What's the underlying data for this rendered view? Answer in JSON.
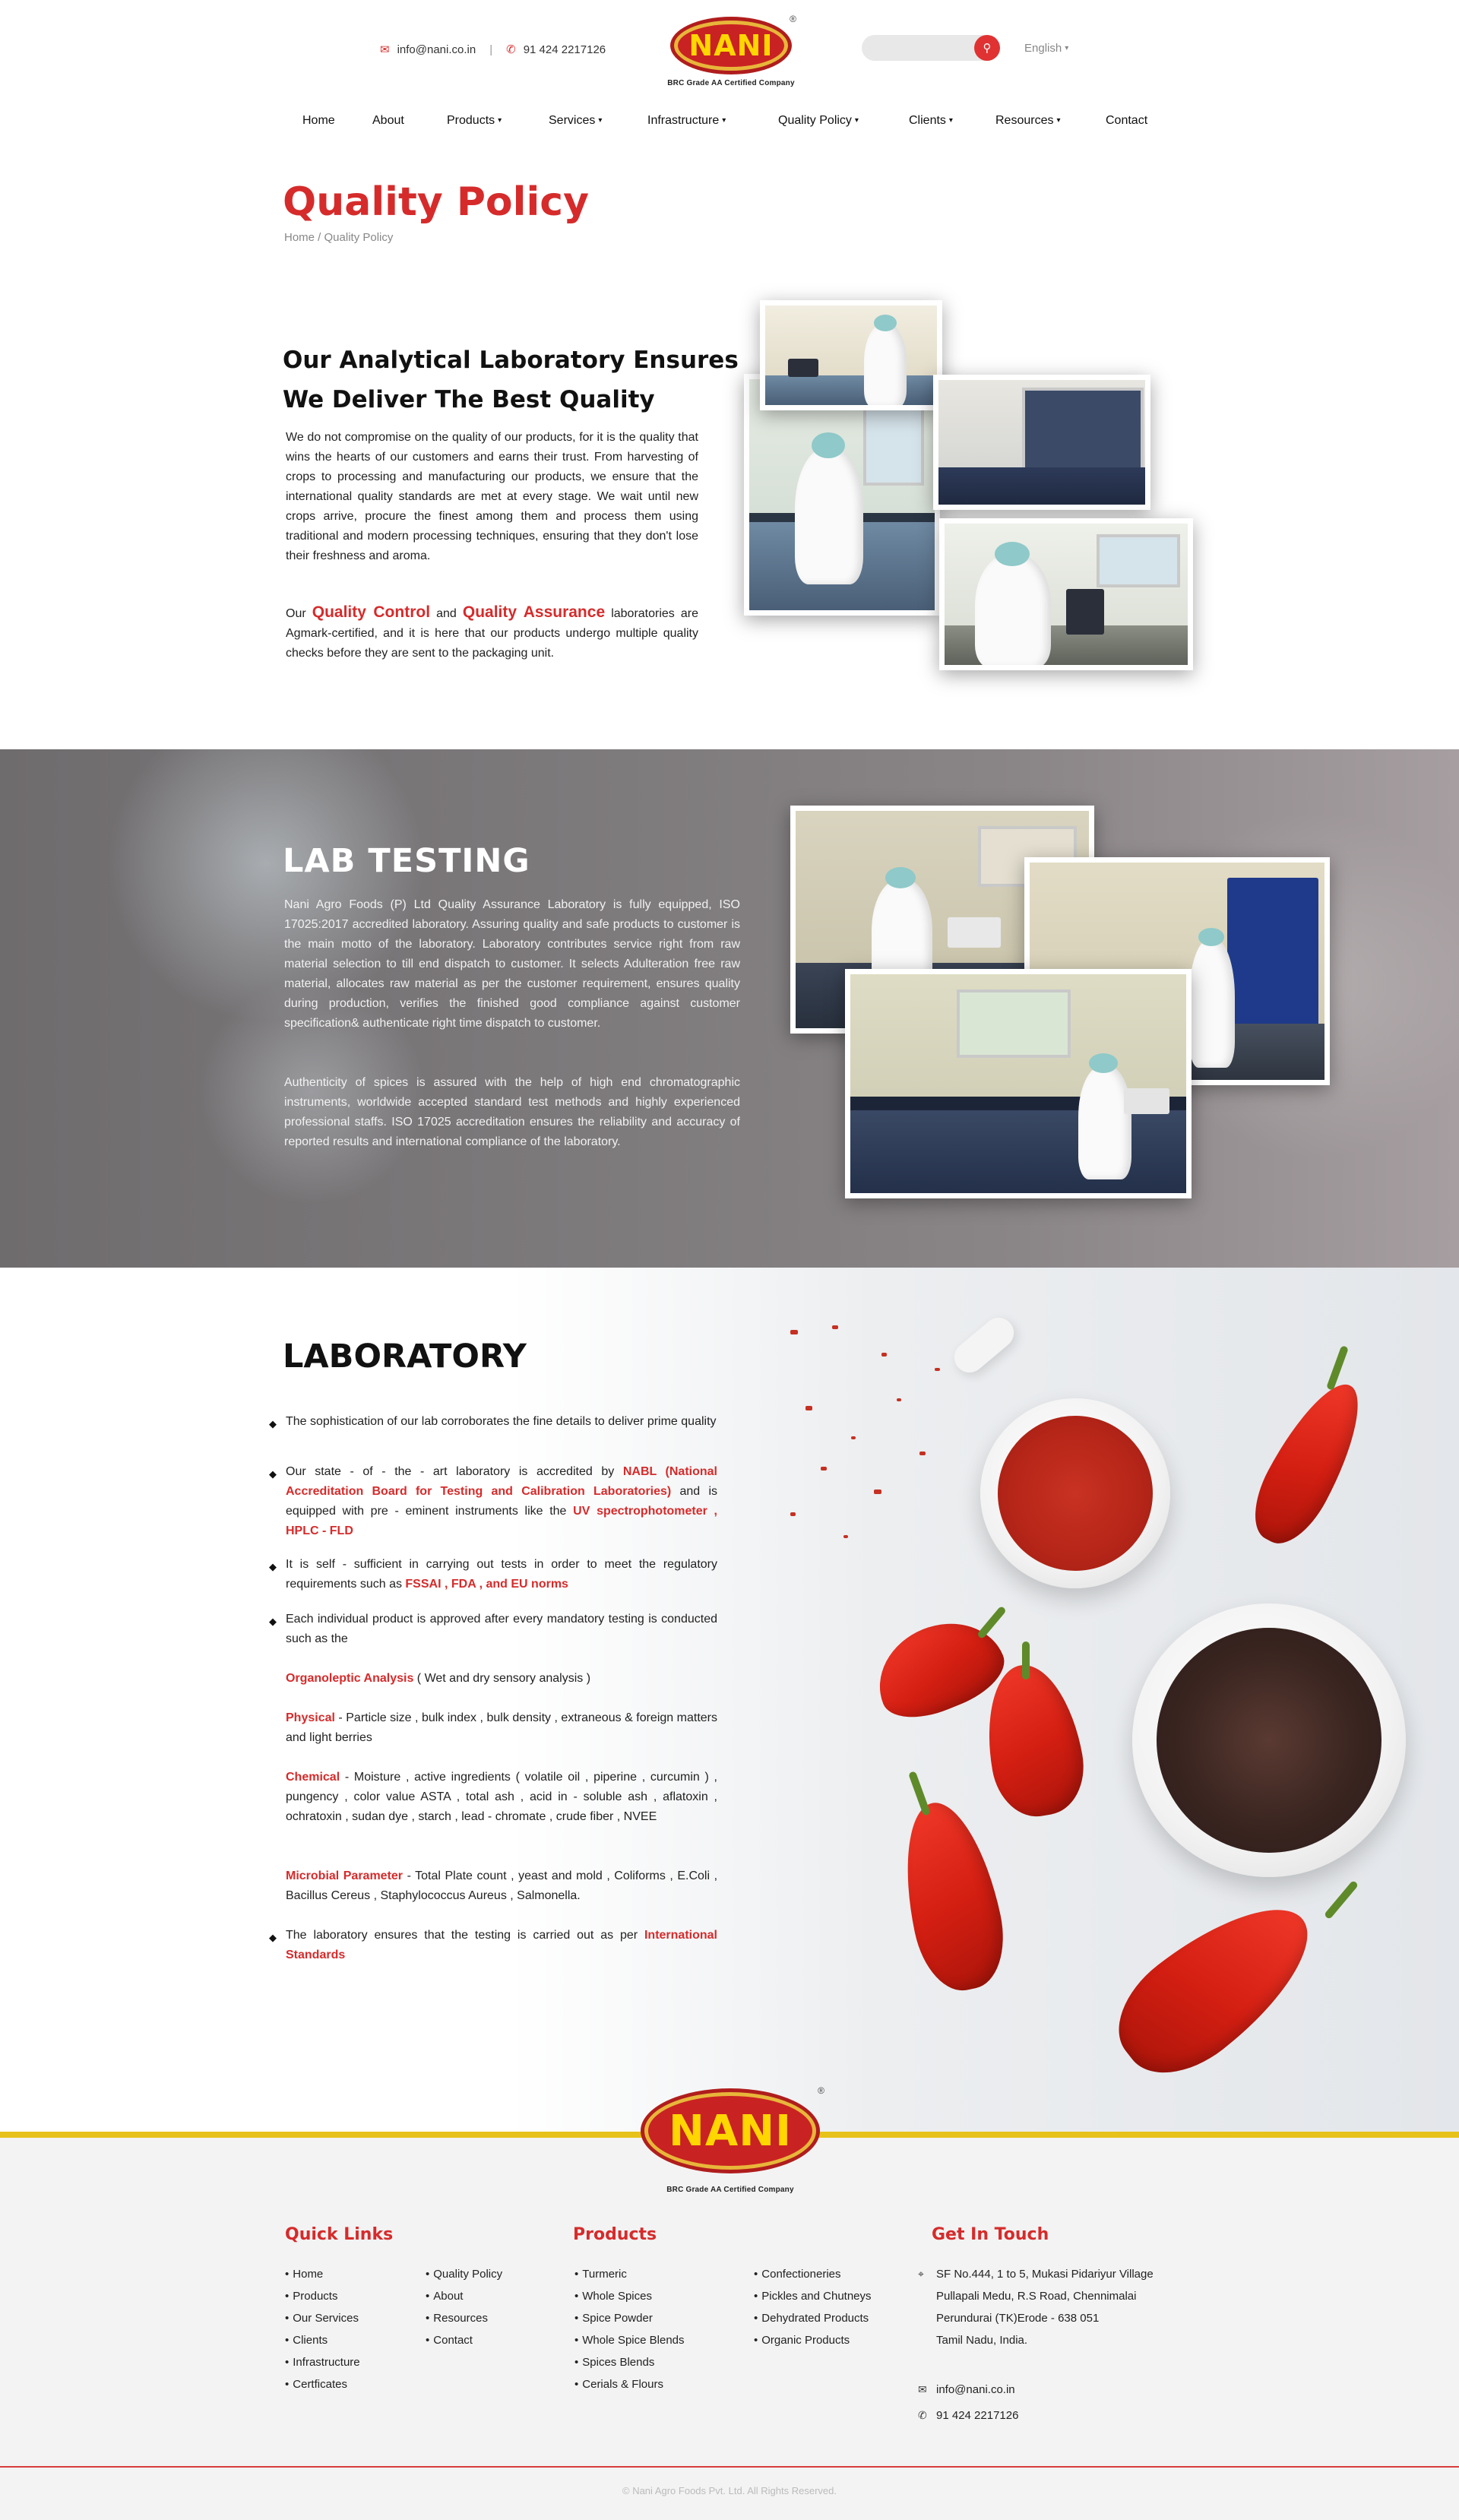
{
  "header": {
    "email": "info@nani.co.in",
    "phone": "91 424 2217126",
    "logo_text": "NANI",
    "logo_caption": "BRC Grade AA Certified Company",
    "language": "English",
    "search_icon": "search-icon"
  },
  "nav": {
    "home": "Home",
    "about": "About",
    "products": "Products",
    "services": "Services",
    "infrastructure": "Infrastructure",
    "quality_policy": "Quality Policy",
    "clients": "Clients",
    "resources": "Resources",
    "contact": "Contact"
  },
  "page": {
    "title": "Quality Policy",
    "breadcrumb": "Home / Quality Policy"
  },
  "analytical": {
    "heading_line1": "Our Analytical Laboratory Ensures",
    "heading_line2": "We Deliver The Best Quality",
    "para1": "We do not compromise on the quality of our products, for it is the quality that wins the hearts of our customers and earns their trust. From harvesting of crops to processing and manufacturing our products, we ensure that the international quality standards are met at every stage. We wait until new crops arrive, procure the finest among them and process them using traditional and modern processing techniques, ensuring that they don't lose their freshness and aroma.",
    "para2_pre": "Our ",
    "para2_hl1": "Quality Control",
    "para2_mid": " and ",
    "para2_hl2": "Quality Assurance",
    "para2_post": " laboratories are Agmark-certified, and it is here that our products undergo multiple quality checks before they are sent to the packaging unit."
  },
  "lab_testing": {
    "title": "LAB TESTING",
    "para1": "Nani Agro Foods (P) Ltd Quality Assurance Laboratory is fully equipped, ISO 17025:2017 accredited laboratory. Assuring quality and safe products to customer is the main motto of the laboratory. Laboratory contributes service right from raw material selection to till end dispatch to customer. It selects Adulteration free raw material, allocates raw material as per the customer requirement, ensures quality during production, verifies the finished good compliance against customer specification& authenticate right time dispatch to customer.",
    "para2": "Authenticity of spices is assured with the help of high end chromatographic instruments, worldwide accepted standard test methods and highly experienced professional staffs. ISO 17025 accreditation ensures the reliability and accuracy of reported results and international compliance of the laboratory."
  },
  "laboratory": {
    "title": "LABORATORY",
    "b1": "The sophistication of our lab corroborates the fine details to deliver prime quality",
    "b2_pre": "Our state - of - the - art laboratory is accredited by ",
    "b2_red": "NABL (National Accreditation Board for Testing and Calibration Laboratories)",
    "b2_mid": " and is equipped with pre - eminent instruments like the ",
    "b2_red2": "UV spectrophotometer , HPLC - FLD",
    "b3_pre": "It is self - sufficient in carrying out tests in order to meet the regulatory requirements such as ",
    "b3_red": "FSSAI , FDA , and EU norms",
    "b4": "Each individual product is approved after every mandatory testing is conducted such as the",
    "organo_red": "Organoleptic Analysis",
    "organo_txt": " ( Wet and dry sensory analysis )",
    "phys_red": "Physical",
    "phys_txt": " - Particle size , bulk index , bulk density , extraneous & foreign matters and light berries",
    "chem_red": "Chemical",
    "chem_txt": " - Moisture , active ingredients ( volatile oil , piperine , curcumin ) , pungency , color value ASTA , total ash , acid in - soluble ash , aflatoxin , ochratoxin , sudan dye , starch , lead - chromate , crude fiber , NVEE",
    "micro_red": "Microbial Parameter",
    "micro_txt": " - Total Plate count , yeast and mold , Coliforms , E.Coli , Bacillus Cereus , Staphylococcus Aureus , Salmonella.",
    "b5_pre": "The laboratory ensures that the testing is carried out as per ",
    "b5_red": "International Standards"
  },
  "footer": {
    "quick_links_title": "Quick Links",
    "products_title": "Products",
    "contact_title": "Get In Touch",
    "quick_col1": [
      "Home",
      "Products",
      "Our Services",
      "Clients",
      "Infrastructure",
      "Certficates"
    ],
    "quick_col2": [
      "Quality Policy",
      "About",
      "Resources",
      "Contact"
    ],
    "prod_col1": [
      "Turmeric",
      "Whole Spices",
      "Spice Powder",
      "Whole Spice Blends",
      "Spices Blends",
      "Cerials & Flours"
    ],
    "prod_col2": [
      "Confectioneries",
      "Pickles and Chutneys",
      "Dehydrated Products",
      "Organic Products"
    ],
    "address": [
      "SF No.444, 1 to 5, Mukasi Pidariyur Village",
      "Pullapali Medu, R.S Road, Chennimalai",
      "Perundurai (TK)Erode - 638 051",
      "Tamil Nadu, India."
    ],
    "email": "info@nani.co.in",
    "phone": "91 424 2217126",
    "copyright": "© Nani Agro Foods Pvt. Ltd. All Rights Reserved."
  },
  "colors": {
    "accent_red": "#d62b2b",
    "footer_band": "#e6c21a"
  }
}
